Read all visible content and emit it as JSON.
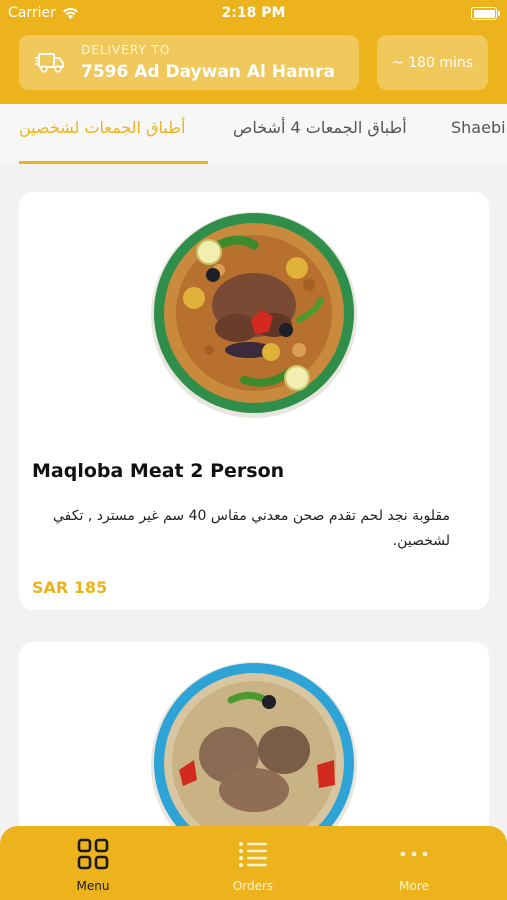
{
  "status_bar": {
    "carrier": "Carrier",
    "time": "2:18 PM"
  },
  "delivery": {
    "label": "DELIVERY TO",
    "address": "7596 Ad Daywan Al Hamra",
    "eta": "~ 180 mins"
  },
  "tabs": [
    {
      "label": "أطباق الجمعات لشخصين",
      "active": true
    },
    {
      "label": "أطباق الجمعات 4 أشخاص",
      "active": false
    },
    {
      "label": "Shaebi",
      "active": false
    }
  ],
  "items": [
    {
      "name": "Maqloba Meat 2 Person",
      "description": "مقلوبة نجد لحم تقدم صحن معدني مقاس 40 سم غير مسترد , تكفي لشخصين.",
      "price": "SAR 185",
      "image_icon": "maqloba-dish-image"
    },
    {
      "image_icon": "rice-meat-dish-image"
    }
  ],
  "bottom_nav": [
    {
      "label": "Menu",
      "icon": "grid-icon",
      "active": true
    },
    {
      "label": "Orders",
      "icon": "list-icon",
      "active": false
    },
    {
      "label": "More",
      "icon": "dots-icon",
      "active": false
    }
  ],
  "colors": {
    "accent": "#ecb31c",
    "background": "#f2f2f2"
  }
}
